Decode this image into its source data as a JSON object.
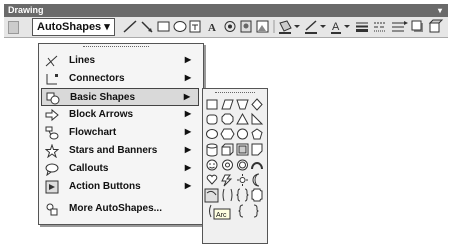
{
  "window": {
    "title": "Drawing"
  },
  "toolbar": {
    "autoshapes_label": "AutoShapes"
  },
  "menu": {
    "items": [
      {
        "label": "Lines",
        "icon": "lines-icon",
        "has_submenu": true
      },
      {
        "label": "Connectors",
        "icon": "connectors-icon",
        "has_submenu": true
      },
      {
        "label": "Basic Shapes",
        "icon": "basic-shapes-icon",
        "has_submenu": true,
        "selected": true
      },
      {
        "label": "Block Arrows",
        "icon": "block-arrows-icon",
        "has_submenu": true
      },
      {
        "label": "Flowchart",
        "icon": "flowchart-icon",
        "has_submenu": true
      },
      {
        "label": "Stars and Banners",
        "icon": "stars-banners-icon",
        "has_submenu": true
      },
      {
        "label": "Callouts",
        "icon": "callouts-icon",
        "has_submenu": true
      },
      {
        "label": "Action Buttons",
        "icon": "action-buttons-icon",
        "has_submenu": true
      },
      {
        "label": "More AutoShapes...",
        "icon": "more-autoshapes-icon",
        "has_submenu": false
      }
    ]
  },
  "palette": {
    "arc_label": "Arc"
  }
}
